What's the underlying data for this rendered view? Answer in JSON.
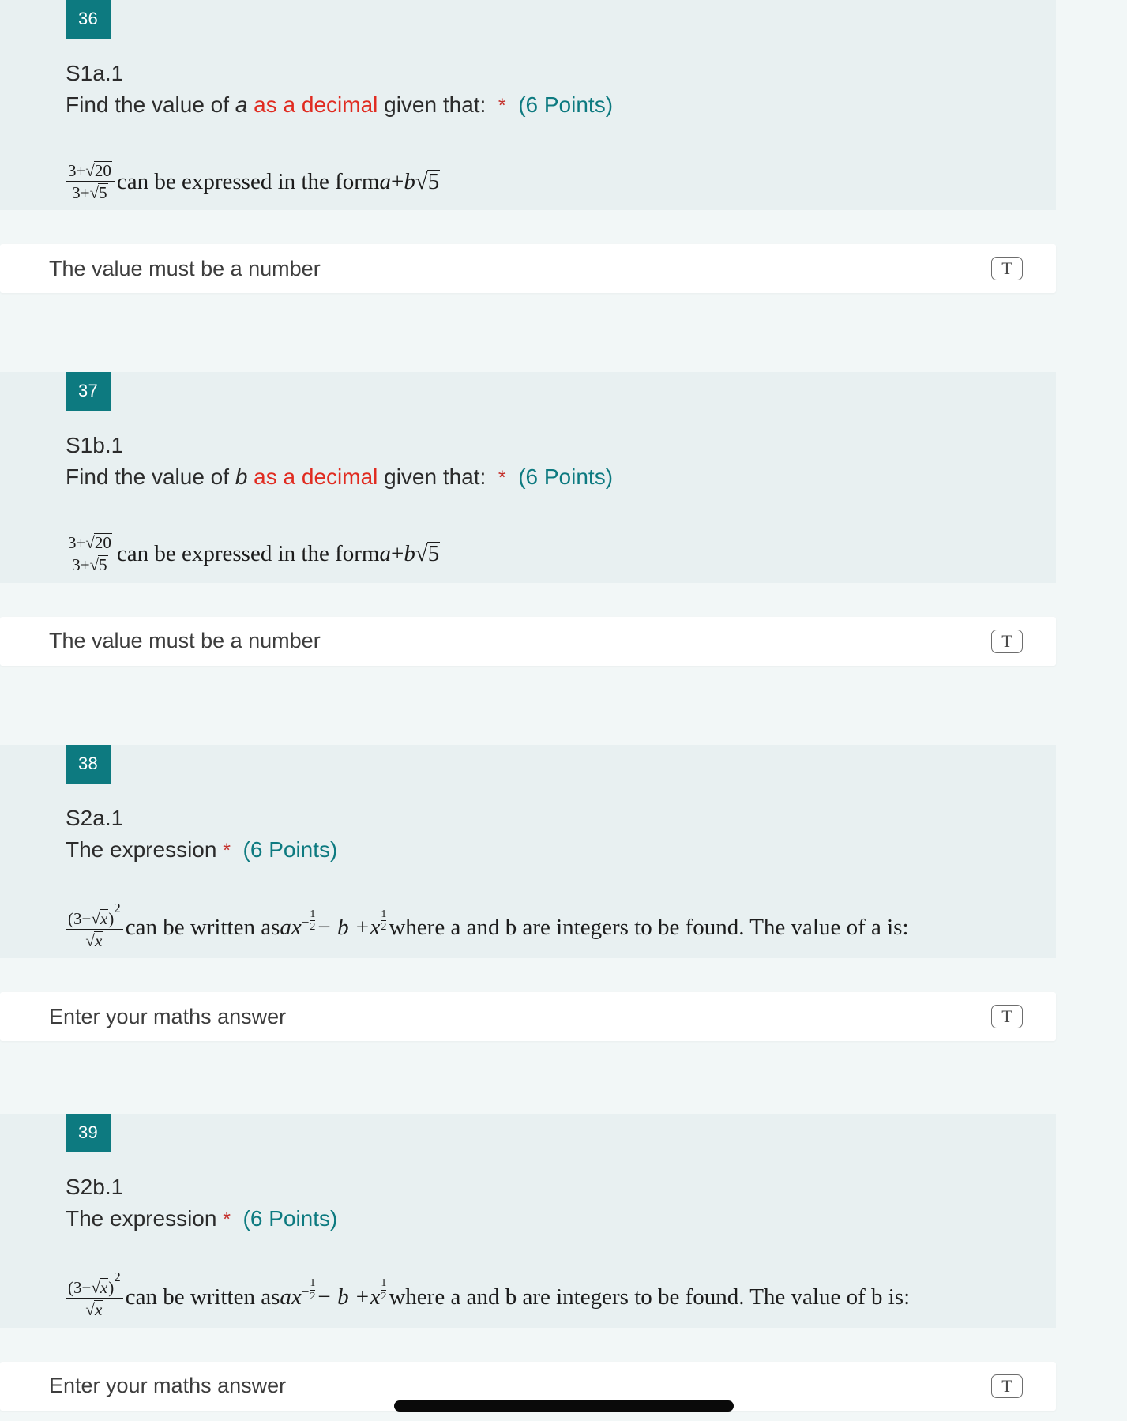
{
  "theme": {
    "badge_bg": "#0d7a80",
    "panel_bg": "#e8f0f1",
    "page_bg": "#f2f7f7",
    "card_bg": "#ffffff",
    "required_color": "#c4302b",
    "points_color": "#0d7a80",
    "highlight_color": "#e02b20"
  },
  "questions": [
    {
      "number": "36",
      "title": "S1a.1",
      "prompt_before": "Find the value of ",
      "prompt_var": "a",
      "prompt_highlight": " as a decimal",
      "prompt_after": " given that:",
      "required_mark": "*",
      "points": "(6 Points)",
      "math": {
        "frac_num_a": "3+",
        "frac_num_rad": "20",
        "frac_den_a": "3+",
        "frac_den_rad": "5",
        "text_after": "can be expressed in the form ",
        "var_a": "a",
        "plus": " + ",
        "var_b": "b",
        "rad_tail": "5"
      },
      "answer_placeholder": "The value must be a number",
      "answer_value": "",
      "input_icon": "text-format-icon",
      "input_icon_glyph": "T"
    },
    {
      "number": "37",
      "title": "S1b.1",
      "prompt_before": "Find the value of ",
      "prompt_var": "b",
      "prompt_highlight": " as a decimal",
      "prompt_after": " given that:",
      "required_mark": "*",
      "points": "(6 Points)",
      "math": {
        "frac_num_a": "3+",
        "frac_num_rad": "20",
        "frac_den_a": "3+",
        "frac_den_rad": "5",
        "text_after": "can be expressed in the form ",
        "var_a": "a",
        "plus": " + ",
        "var_b": "b",
        "rad_tail": "5"
      },
      "answer_placeholder": "The value must be a number",
      "answer_value": "",
      "input_icon": "text-format-icon",
      "input_icon_glyph": "T"
    },
    {
      "number": "38",
      "title": "S2a.1",
      "prompt_before": "The expression",
      "prompt_var": "",
      "prompt_highlight": "",
      "prompt_after": "",
      "required_mark": "*",
      "points": "(6 Points)",
      "math2": {
        "num_open": "(3−",
        "num_rad": "x",
        "num_close": ")",
        "num_pow": "2",
        "den_rad": "x",
        "text_mid": "can be written as ",
        "coef": "ax",
        "exp1_sign": "−",
        "exp1_num": "1",
        "exp1_den": "2",
        "minus_b": " − b + ",
        "term_x": "x",
        "exp2_num": "1",
        "exp2_den": "2",
        "text_end": " where a and b are integers to be found. The value of a is:"
      },
      "answer_placeholder": "Enter your maths answer",
      "answer_value": "",
      "input_icon": "text-format-icon",
      "input_icon_glyph": "T"
    },
    {
      "number": "39",
      "title": "S2b.1",
      "prompt_before": "The expression",
      "prompt_var": "",
      "prompt_highlight": "",
      "prompt_after": "",
      "required_mark": "*",
      "points": "(6 Points)",
      "math2": {
        "num_open": "(3−",
        "num_rad": "x",
        "num_close": ")",
        "num_pow": "2",
        "den_rad": "x",
        "text_mid": "can be written as ",
        "coef": "ax",
        "exp1_sign": "−",
        "exp1_num": "1",
        "exp1_den": "2",
        "minus_b": " − b + ",
        "term_x": "x",
        "exp2_num": "1",
        "exp2_den": "2",
        "text_end": " where a and b are integers to be found. The value of b is:"
      },
      "answer_placeholder": "Enter your maths answer",
      "answer_value": "",
      "input_icon": "text-format-icon",
      "input_icon_glyph": "T"
    }
  ],
  "home_indicator": "home-indicator-bar"
}
